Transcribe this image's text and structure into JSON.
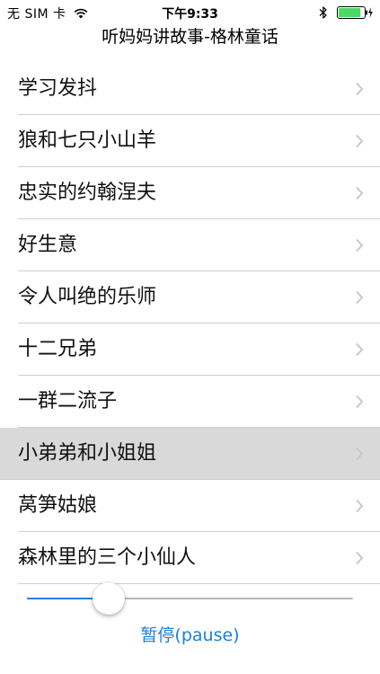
{
  "status_bar": {
    "carrier": "无 SIM 卡",
    "time": "下午9:33",
    "wifi_icon": "wifi-icon",
    "bluetooth_icon": "bluetooth-icon",
    "battery_icon": "battery-charging-icon",
    "battery_level": 0.9
  },
  "nav": {
    "title": "听妈妈讲故事-格林童话"
  },
  "stories": [
    {
      "label": "学习发抖",
      "selected": false
    },
    {
      "label": "狼和七只小山羊",
      "selected": false
    },
    {
      "label": "忠实的约翰涅夫",
      "selected": false
    },
    {
      "label": "好生意",
      "selected": false
    },
    {
      "label": "令人叫绝的乐师",
      "selected": false
    },
    {
      "label": "十二兄弟",
      "selected": false
    },
    {
      "label": "一群二流子",
      "selected": false
    },
    {
      "label": "小弟弟和小姐姐",
      "selected": true
    },
    {
      "label": "莴笋姑娘",
      "selected": false
    },
    {
      "label": "森林里的三个小仙人",
      "selected": false
    }
  ],
  "player": {
    "progress": 0.25,
    "pause_label": "暂停(pause)"
  },
  "colors": {
    "accent": "#1a7fe0",
    "selected_row": "#d9d9d9",
    "battery_fill": "#4cd964"
  }
}
